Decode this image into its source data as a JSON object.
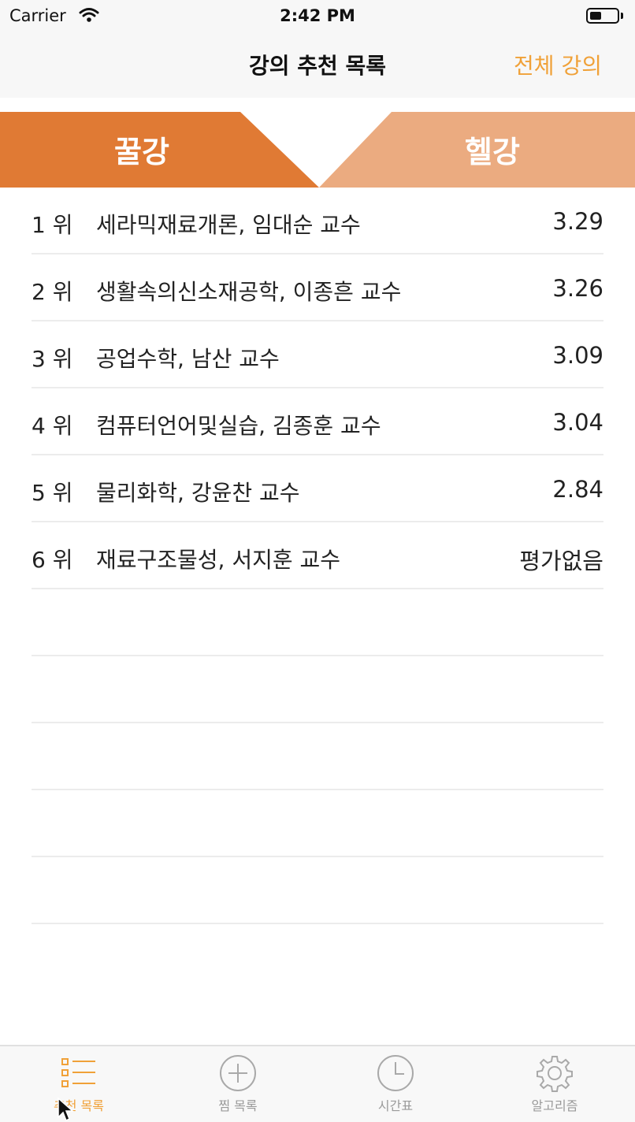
{
  "status_bar": {
    "carrier": "Carrier",
    "time": "2:42 PM"
  },
  "nav": {
    "title": "강의 추천 목록",
    "right_button": "전체 강의"
  },
  "segment": {
    "left": "꿀강",
    "right": "헬강",
    "active": "left",
    "colors": {
      "active": "#e07a34",
      "inactive": "#ebab80"
    }
  },
  "list": {
    "items": [
      {
        "rank": "1 위",
        "title": "세라믹재료개론, 임대순 교수",
        "score": "3.29"
      },
      {
        "rank": "2 위",
        "title": "생활속의신소재공학, 이종흔 교수",
        "score": "3.26"
      },
      {
        "rank": "3 위",
        "title": "공업수학, 남산 교수",
        "score": "3.09"
      },
      {
        "rank": "4 위",
        "title": "컴퓨터언어및실습, 김종훈 교수",
        "score": "3.04"
      },
      {
        "rank": "5 위",
        "title": "물리화학, 강윤찬 교수",
        "score": "2.84"
      },
      {
        "rank": "6 위",
        "title": "재료구조물성, 서지훈 교수",
        "score": "평가없음"
      }
    ]
  },
  "tabbar": {
    "items": [
      {
        "label": "추천 목록",
        "icon": "list-icon",
        "active": true
      },
      {
        "label": "찜 목록",
        "icon": "plus-circle-icon",
        "active": false
      },
      {
        "label": "시간표",
        "icon": "clock-icon",
        "active": false
      },
      {
        "label": "알고리즘",
        "icon": "gear-icon",
        "active": false
      }
    ],
    "accent": "#f0a138"
  }
}
